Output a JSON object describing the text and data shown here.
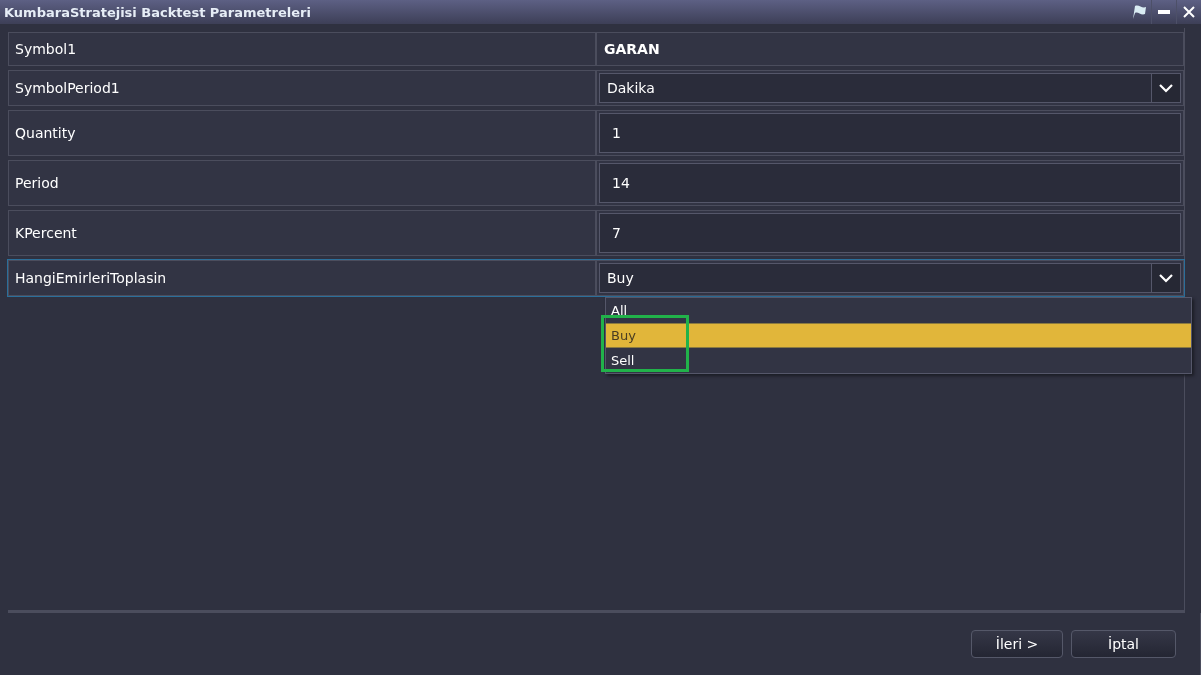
{
  "window": {
    "title": "KumbaraStratejisi Backtest Parametreleri"
  },
  "parameters": [
    {
      "name": "Symbol1",
      "kind": "text",
      "value": "GARAN",
      "focused": false
    },
    {
      "name": "SymbolPeriod1",
      "kind": "combo",
      "value": "Dakika",
      "focused": false
    },
    {
      "name": "Quantity",
      "kind": "number",
      "value": "1",
      "focused": false
    },
    {
      "name": "Period",
      "kind": "number",
      "value": "14",
      "focused": false
    },
    {
      "name": "KPercent",
      "kind": "number",
      "value": "7",
      "focused": false
    },
    {
      "name": "HangiEmirleriToplasin",
      "kind": "combo",
      "value": "Buy",
      "focused": true,
      "options": [
        {
          "label": "All",
          "selected": false
        },
        {
          "label": "Buy",
          "selected": true
        },
        {
          "label": "Sell",
          "selected": false
        }
      ]
    }
  ],
  "buttons": [
    {
      "label": "İleri >"
    },
    {
      "label": "İptal"
    }
  ]
}
